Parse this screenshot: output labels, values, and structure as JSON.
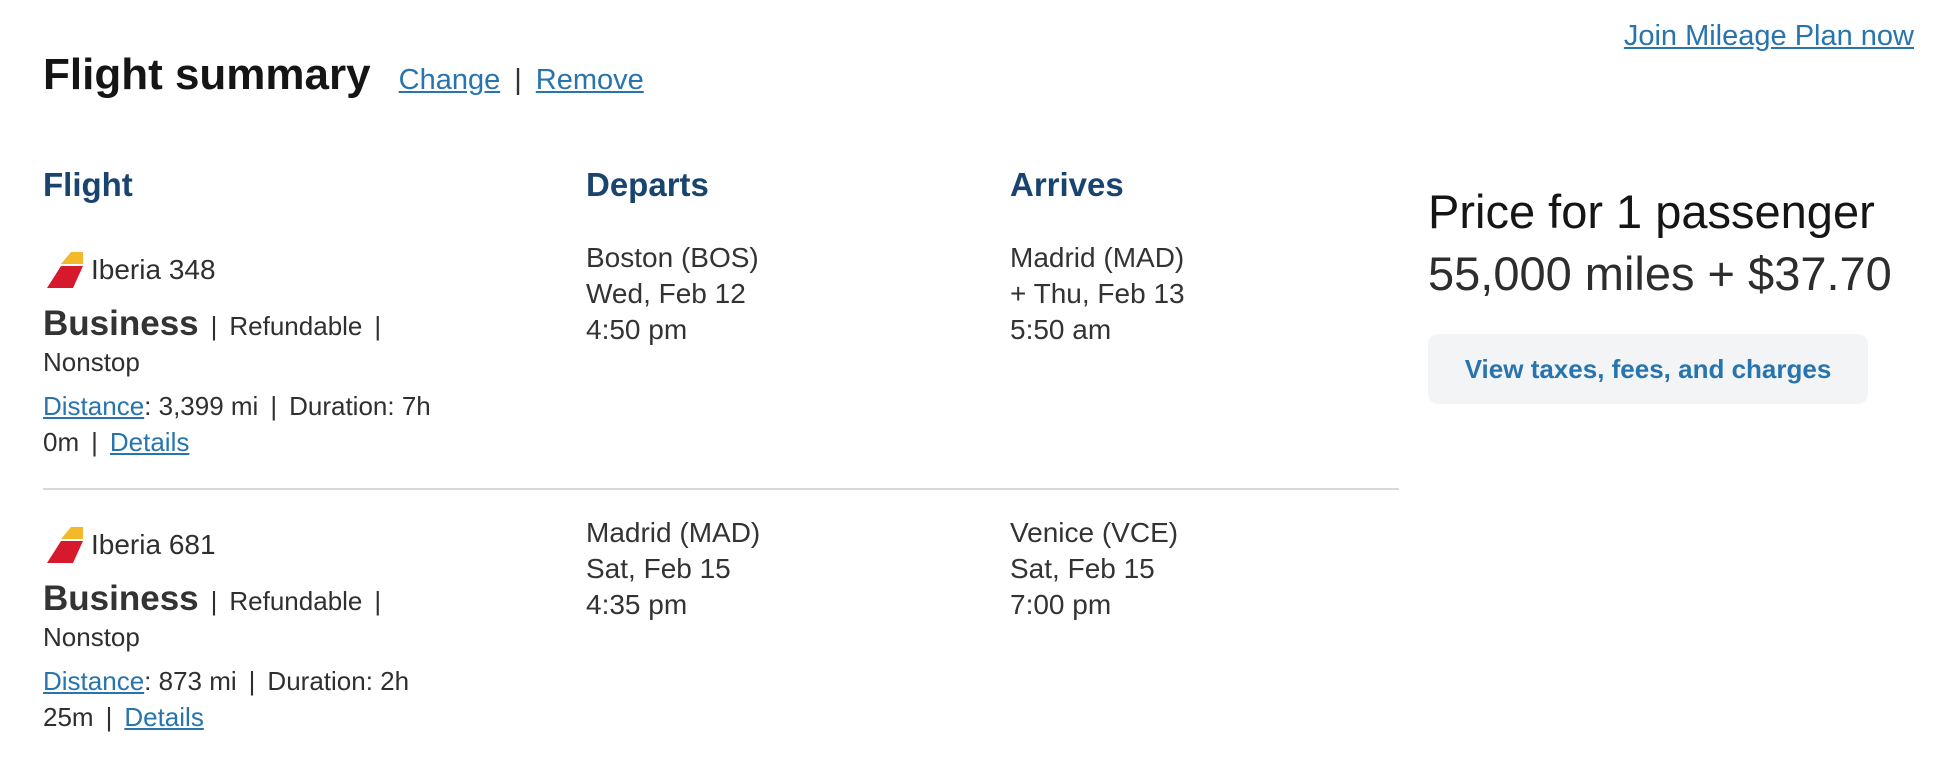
{
  "top_link": "Join Mileage Plan now",
  "header": {
    "title": "Flight summary",
    "change": "Change",
    "separator": "|",
    "remove": "Remove"
  },
  "columns": {
    "flight": "Flight",
    "departs": "Departs",
    "arrives": "Arrives"
  },
  "segments": [
    {
      "airline": "Iberia 348",
      "cabin": "Business",
      "pipe": "|",
      "refundable": "Refundable",
      "nonstop": "Nonstop",
      "distance_label": "Distance",
      "distance_value": ": 3,399 mi",
      "duration_a": "Duration: 7h",
      "duration_b": "0m",
      "details": "Details",
      "depart": {
        "city": "Boston (BOS)",
        "date": "Wed, Feb 12",
        "time": "4:50 pm"
      },
      "arrive": {
        "city": "Madrid (MAD)",
        "date": "+ Thu, Feb 13",
        "time": "5:50 am"
      }
    },
    {
      "airline": "Iberia 681",
      "cabin": "Business",
      "pipe": "|",
      "refundable": "Refundable",
      "nonstop": "Nonstop",
      "distance_label": "Distance",
      "distance_value": ": 873 mi",
      "duration_a": "Duration: 2h",
      "duration_b": "25m",
      "details": "Details",
      "depart": {
        "city": "Madrid (MAD)",
        "date": "Sat, Feb 15",
        "time": "4:35 pm"
      },
      "arrive": {
        "city": "Venice (VCE)",
        "date": "Sat, Feb 15",
        "time": "7:00 pm"
      }
    }
  ],
  "price": {
    "title": "Price for 1 passenger",
    "amount": "55,000 miles + $37.70",
    "fees_button": "View taxes, fees, and charges"
  },
  "colors": {
    "link": "#2774ae",
    "heading": "#1a4470",
    "logo_red": "#d7192d",
    "logo_gold": "#f2b92b",
    "button_bg": "#f3f4f5"
  },
  "icons": {
    "airline_logo": "iberia-tail-logo-icon"
  }
}
